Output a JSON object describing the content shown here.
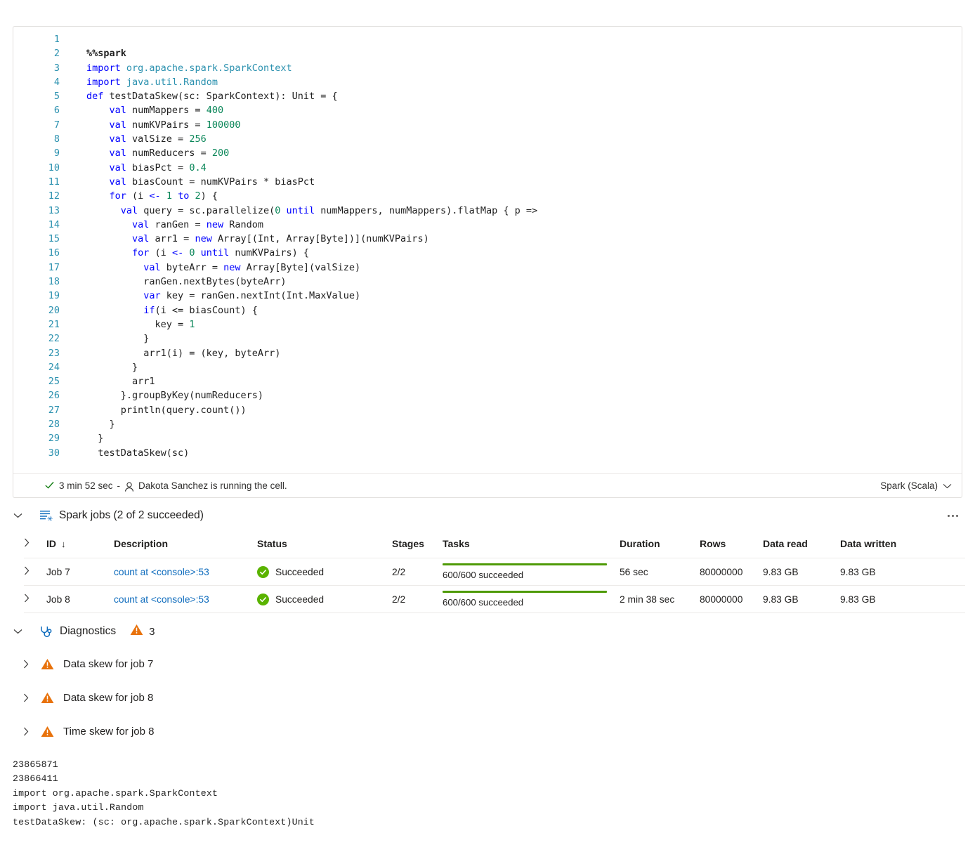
{
  "cell": {
    "language_selector": "Spark (Scala)",
    "status": {
      "duration": "3 min 52 sec",
      "separator": "-",
      "running_text": "Dakota Sanchez is running the cell."
    },
    "code_lines": [
      {
        "n": "1",
        "tokens": []
      },
      {
        "n": "2",
        "tokens": [
          {
            "t": "%%spark",
            "c": "mag"
          }
        ]
      },
      {
        "n": "3",
        "tokens": [
          {
            "t": "import ",
            "c": "kw"
          },
          {
            "t": "org.apache.spark.SparkContext",
            "c": "typ"
          }
        ]
      },
      {
        "n": "4",
        "tokens": [
          {
            "t": "import ",
            "c": "kw"
          },
          {
            "t": "java.util.Random",
            "c": "typ"
          }
        ]
      },
      {
        "n": "5",
        "tokens": [
          {
            "t": "def ",
            "c": "kw"
          },
          {
            "t": "testDataSkew(sc: SparkContext): Unit = {",
            "c": "plain"
          }
        ]
      },
      {
        "n": "6",
        "tokens": [
          {
            "t": "    ",
            "c": "plain"
          },
          {
            "t": "val ",
            "c": "kw"
          },
          {
            "t": "numMappers = ",
            "c": "plain"
          },
          {
            "t": "400",
            "c": "num"
          }
        ]
      },
      {
        "n": "7",
        "tokens": [
          {
            "t": "    ",
            "c": "plain"
          },
          {
            "t": "val ",
            "c": "kw"
          },
          {
            "t": "numKVPairs = ",
            "c": "plain"
          },
          {
            "t": "100000",
            "c": "num"
          }
        ]
      },
      {
        "n": "8",
        "tokens": [
          {
            "t": "    ",
            "c": "plain"
          },
          {
            "t": "val ",
            "c": "kw"
          },
          {
            "t": "valSize = ",
            "c": "plain"
          },
          {
            "t": "256",
            "c": "num"
          }
        ]
      },
      {
        "n": "9",
        "tokens": [
          {
            "t": "    ",
            "c": "plain"
          },
          {
            "t": "val ",
            "c": "kw"
          },
          {
            "t": "numReducers = ",
            "c": "plain"
          },
          {
            "t": "200",
            "c": "num"
          }
        ]
      },
      {
        "n": "10",
        "tokens": [
          {
            "t": "    ",
            "c": "plain"
          },
          {
            "t": "val ",
            "c": "kw"
          },
          {
            "t": "biasPct = ",
            "c": "plain"
          },
          {
            "t": "0.4",
            "c": "num"
          }
        ]
      },
      {
        "n": "11",
        "tokens": [
          {
            "t": "    ",
            "c": "plain"
          },
          {
            "t": "val ",
            "c": "kw"
          },
          {
            "t": "biasCount = numKVPairs * biasPct",
            "c": "plain"
          }
        ]
      },
      {
        "n": "12",
        "tokens": [
          {
            "t": "    ",
            "c": "plain"
          },
          {
            "t": "for ",
            "c": "kw"
          },
          {
            "t": "(i ",
            "c": "plain"
          },
          {
            "t": "<- ",
            "c": "kw"
          },
          {
            "t": "1 ",
            "c": "num"
          },
          {
            "t": "to ",
            "c": "kw"
          },
          {
            "t": "2",
            "c": "num"
          },
          {
            "t": ") {",
            "c": "plain"
          }
        ]
      },
      {
        "n": "13",
        "tokens": [
          {
            "t": "      ",
            "c": "plain"
          },
          {
            "t": "val ",
            "c": "kw"
          },
          {
            "t": "query = sc.parallelize(",
            "c": "plain"
          },
          {
            "t": "0 ",
            "c": "num"
          },
          {
            "t": "until ",
            "c": "kw"
          },
          {
            "t": "numMappers, numMappers).flatMap { p =>",
            "c": "plain"
          }
        ]
      },
      {
        "n": "14",
        "tokens": [
          {
            "t": "        ",
            "c": "plain"
          },
          {
            "t": "val ",
            "c": "kw"
          },
          {
            "t": "ranGen = ",
            "c": "plain"
          },
          {
            "t": "new ",
            "c": "kw"
          },
          {
            "t": "Random",
            "c": "plain"
          }
        ]
      },
      {
        "n": "15",
        "tokens": [
          {
            "t": "        ",
            "c": "plain"
          },
          {
            "t": "val ",
            "c": "kw"
          },
          {
            "t": "arr1 = ",
            "c": "plain"
          },
          {
            "t": "new ",
            "c": "kw"
          },
          {
            "t": "Array[(Int, Array[Byte])](numKVPairs)",
            "c": "plain"
          }
        ]
      },
      {
        "n": "16",
        "tokens": [
          {
            "t": "        ",
            "c": "plain"
          },
          {
            "t": "for ",
            "c": "kw"
          },
          {
            "t": "(i ",
            "c": "plain"
          },
          {
            "t": "<- ",
            "c": "kw"
          },
          {
            "t": "0 ",
            "c": "num"
          },
          {
            "t": "until ",
            "c": "kw"
          },
          {
            "t": "numKVPairs) {",
            "c": "plain"
          }
        ]
      },
      {
        "n": "17",
        "tokens": [
          {
            "t": "          ",
            "c": "plain"
          },
          {
            "t": "val ",
            "c": "kw"
          },
          {
            "t": "byteArr = ",
            "c": "plain"
          },
          {
            "t": "new ",
            "c": "kw"
          },
          {
            "t": "Array[Byte](valSize)",
            "c": "plain"
          }
        ]
      },
      {
        "n": "18",
        "tokens": [
          {
            "t": "          ranGen.nextBytes(byteArr)",
            "c": "plain"
          }
        ]
      },
      {
        "n": "19",
        "tokens": [
          {
            "t": "          ",
            "c": "plain"
          },
          {
            "t": "var ",
            "c": "kw"
          },
          {
            "t": "key = ranGen.nextInt(Int.MaxValue)",
            "c": "plain"
          }
        ]
      },
      {
        "n": "20",
        "tokens": [
          {
            "t": "          ",
            "c": "plain"
          },
          {
            "t": "if",
            "c": "kw"
          },
          {
            "t": "(i <= biasCount) {",
            "c": "plain"
          }
        ]
      },
      {
        "n": "21",
        "tokens": [
          {
            "t": "            key = ",
            "c": "plain"
          },
          {
            "t": "1",
            "c": "num"
          }
        ]
      },
      {
        "n": "22",
        "tokens": [
          {
            "t": "          }",
            "c": "plain"
          }
        ]
      },
      {
        "n": "23",
        "tokens": [
          {
            "t": "          arr1(i) = (key, byteArr)",
            "c": "plain"
          }
        ]
      },
      {
        "n": "24",
        "tokens": [
          {
            "t": "        }",
            "c": "plain"
          }
        ]
      },
      {
        "n": "25",
        "tokens": [
          {
            "t": "        arr1",
            "c": "plain"
          }
        ]
      },
      {
        "n": "26",
        "tokens": [
          {
            "t": "      }.groupByKey(numReducers)",
            "c": "plain"
          }
        ]
      },
      {
        "n": "27",
        "tokens": [
          {
            "t": "      println(query.count())",
            "c": "plain"
          }
        ]
      },
      {
        "n": "28",
        "tokens": [
          {
            "t": "    }",
            "c": "plain"
          }
        ]
      },
      {
        "n": "29",
        "tokens": [
          {
            "t": "  }",
            "c": "plain"
          }
        ]
      },
      {
        "n": "30",
        "tokens": [
          {
            "t": "  testDataSkew(sc)",
            "c": "plain"
          }
        ]
      }
    ]
  },
  "spark_jobs": {
    "title": "Spark jobs (2 of 2 succeeded)",
    "columns": [
      "ID",
      "Description",
      "Status",
      "Stages",
      "Tasks",
      "Duration",
      "Rows",
      "Data read",
      "Data written"
    ],
    "sort_column": "ID",
    "sort_direction": "↓",
    "rows": [
      {
        "id": "Job 7",
        "description": "count at <console>:53",
        "status": "Succeeded",
        "stages": "2/2",
        "tasks": "600/600 succeeded",
        "tasks_percent": 100,
        "duration": "56 sec",
        "rows": "80000000",
        "data_read": "9.83 GB",
        "data_written": "9.83 GB"
      },
      {
        "id": "Job 8",
        "description": "count at <console>:53",
        "status": "Succeeded",
        "stages": "2/2",
        "tasks": "600/600 succeeded",
        "tasks_percent": 100,
        "duration": "2 min 38 sec",
        "rows": "80000000",
        "data_read": "9.83 GB",
        "data_written": "9.83 GB"
      }
    ]
  },
  "diagnostics": {
    "title": "Diagnostics",
    "warning_count": "3",
    "items": [
      {
        "label": "Data skew for job 7"
      },
      {
        "label": "Data skew for job 8"
      },
      {
        "label": "Time skew for job 8"
      }
    ]
  },
  "output": {
    "lines": [
      "23865871",
      "23866411",
      "import org.apache.spark.SparkContext",
      "import java.util.Random",
      "testDataSkew: (sc: org.apache.spark.SparkContext)Unit"
    ]
  },
  "colors": {
    "success_green": "#5ab300",
    "progress_green": "#4e9a06",
    "warning_orange": "#e8720c",
    "link_blue": "#0f6cbd",
    "accent_blue": "#0f6cbd"
  }
}
